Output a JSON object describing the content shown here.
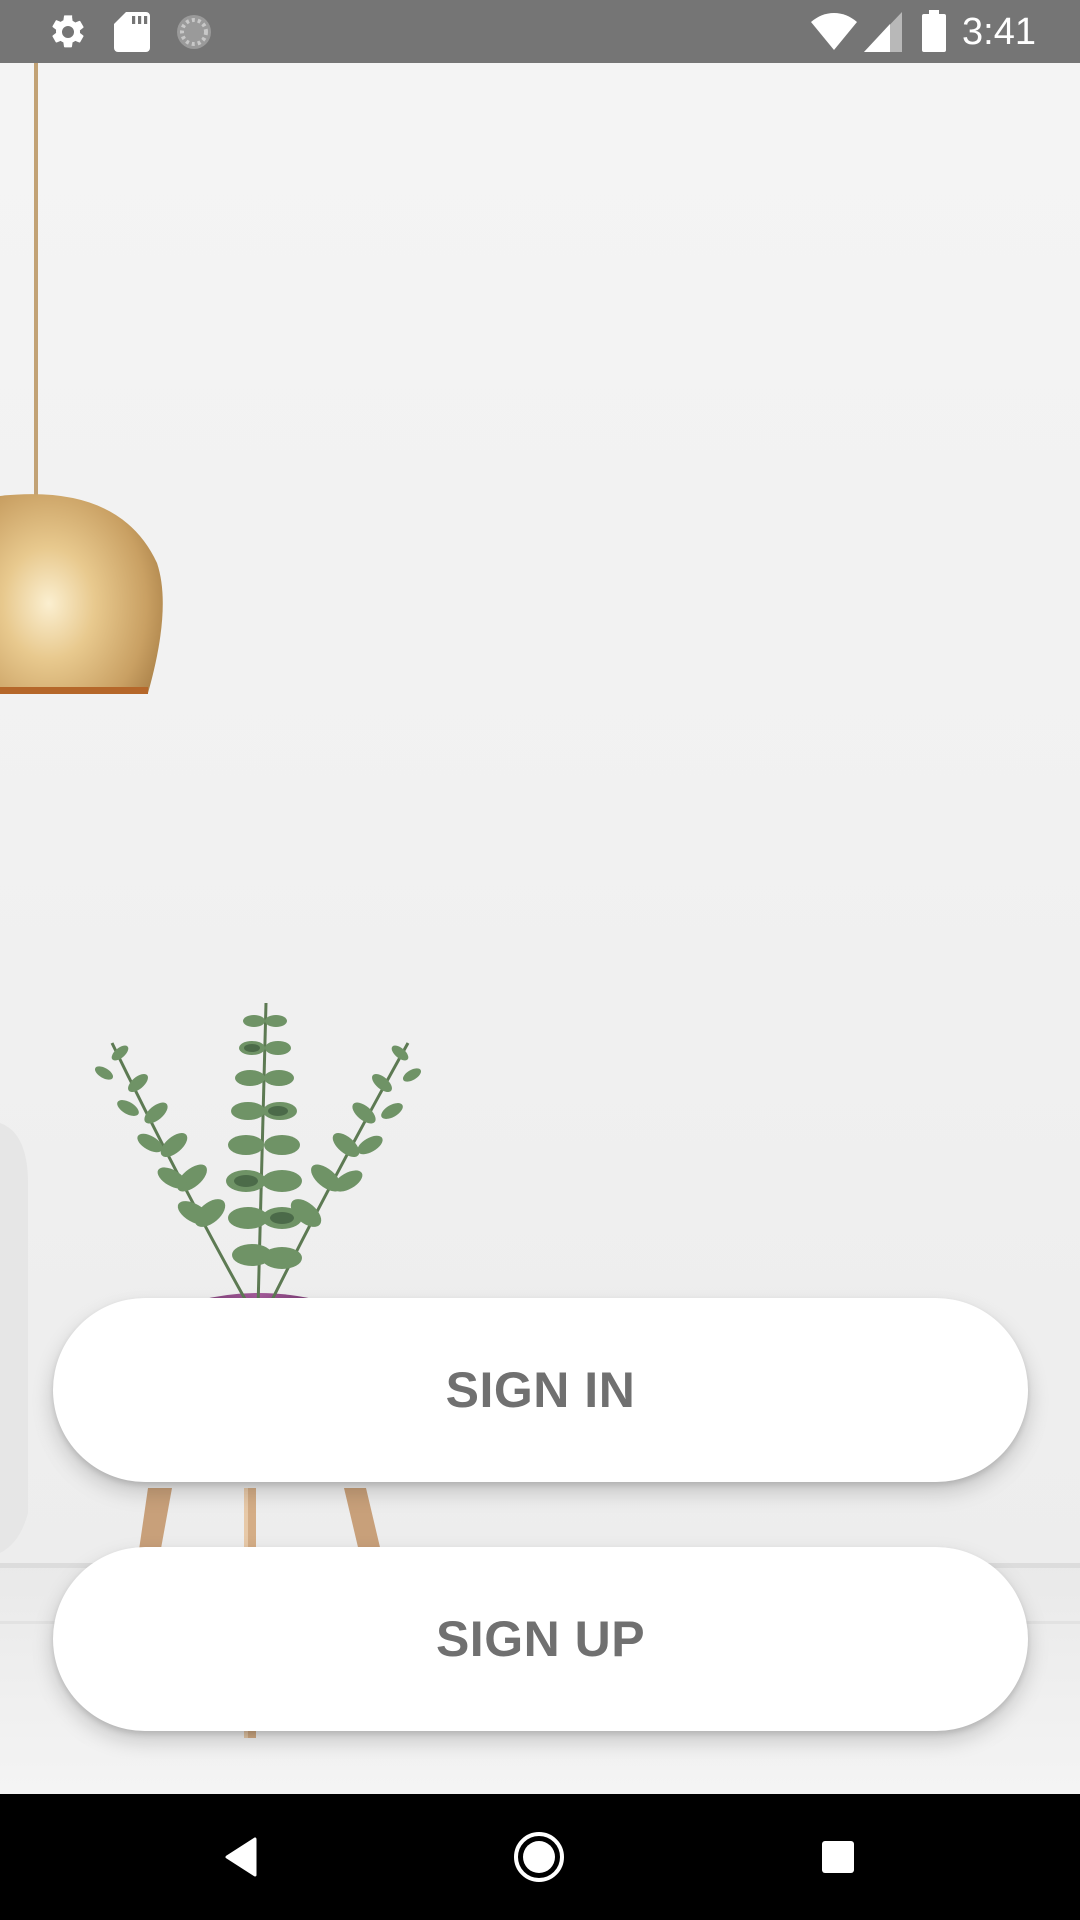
{
  "status_bar": {
    "time": "3:41",
    "left_icons": [
      "settings-icon",
      "sd-card-icon",
      "sync-icon"
    ],
    "right_icons": [
      "wifi-icon",
      "cell-signal-icon",
      "battery-icon"
    ],
    "background_color": "#757575"
  },
  "buttons": {
    "sign_in_label": "SIGN IN",
    "sign_up_label": "SIGN UP",
    "text_color": "#707070",
    "background_color": "#ffffff"
  },
  "nav_bar": {
    "icons": [
      "back-icon",
      "home-icon",
      "recents-icon"
    ],
    "background_color": "#000000"
  },
  "background": {
    "description_icons": [
      "pendant-lamp",
      "plant-in-vase",
      "side-table"
    ]
  }
}
